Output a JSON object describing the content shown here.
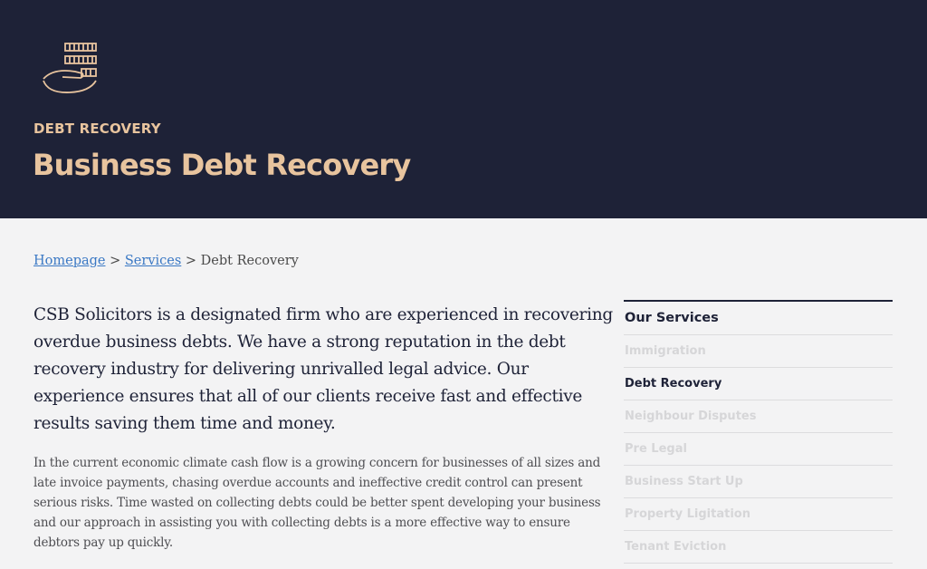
{
  "header": {
    "logo_icon": "coins-hand-icon",
    "eyebrow": "DEBT RECOVERY",
    "title": "Business Debt Recovery"
  },
  "breadcrumb": {
    "home": "Homepage",
    "sep1": ">",
    "services": "Services",
    "sep2": ">",
    "current": "Debt Recovery"
  },
  "content": {
    "intro": "CSB Solicitors is a designated firm who are experienced in recovering overdue business debts. We have a strong reputation in the debt recovery industry for delivering unrivalled legal advice. Our experience ensures that all of our clients receive fast and effective results saving them time and money.",
    "body": "In the current economic climate cash flow is a growing concern for businesses of all sizes and late invoice payments, chasing overdue accounts and ineffective credit control can present serious risks. Time wasted on collecting debts could be better spent developing your business and our approach in assisting you with collecting debts is a more effective way to ensure debtors pay up quickly."
  },
  "sidebar": {
    "heading": "Our Services",
    "items": [
      {
        "label": "Immigration"
      },
      {
        "label": "Debt Recovery"
      },
      {
        "label": "Neighbour Disputes"
      },
      {
        "label": "Pre Legal"
      },
      {
        "label": "Business Start Up"
      },
      {
        "label": "Property Ligitation"
      },
      {
        "label": "Tenant Eviction"
      }
    ],
    "active_label": "Debt Recovery"
  },
  "colors": {
    "header_bg": "#1e2237",
    "accent": "#e8c49e",
    "link": "#3a78c4"
  }
}
